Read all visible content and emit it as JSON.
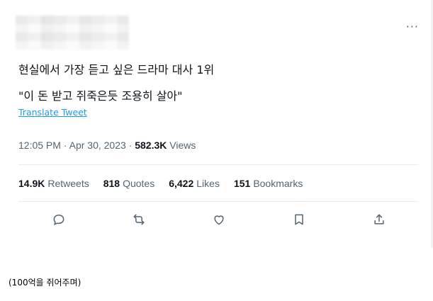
{
  "tweet": {
    "text_line1": "현실에서 가장 듣고 싶은 드라마 대사 1위",
    "text_line2": "\"이 돈 받고 쥐죽은듯 조용히 살아\"",
    "translate_label": "Translate Tweet",
    "time": "12:05 PM",
    "date": "Apr 30, 2023",
    "views_count": "582.3K",
    "views_label": "Views",
    "more_label": "···"
  },
  "stats": [
    {
      "count": "14.9K",
      "label": "Retweets"
    },
    {
      "count": "818",
      "label": "Quotes"
    },
    {
      "count": "6,422",
      "label": "Likes"
    },
    {
      "count": "151",
      "label": "Bookmarks"
    }
  ],
  "actions": [
    {
      "icon": "reply-icon"
    },
    {
      "icon": "retweet-icon"
    },
    {
      "icon": "like-icon"
    },
    {
      "icon": "bookmark-icon"
    },
    {
      "icon": "share-icon"
    }
  ],
  "caption": "(100억을 쥐어주며)",
  "colors": {
    "link": "#1d9bf0",
    "muted": "#536471",
    "text": "#0f1419",
    "divider": "#e6ecf0"
  }
}
